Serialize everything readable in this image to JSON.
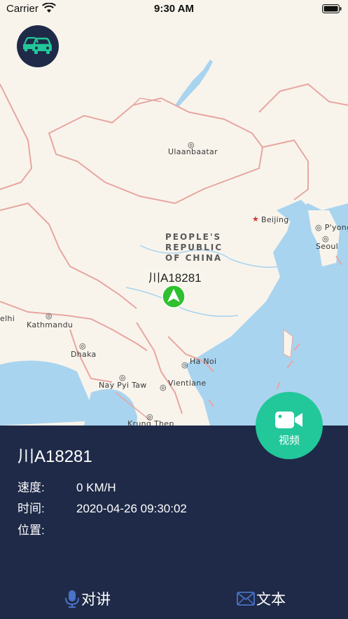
{
  "status_bar": {
    "carrier": "Carrier",
    "time": "9:30 AM"
  },
  "map": {
    "labels": {
      "ulaanbaatar": "Ulaanbaatar",
      "beijing": "Beijing",
      "pyong": "P'yong",
      "seoul": "Seoul",
      "kathmandu": "Kathmandu",
      "delhi": "elhi",
      "dhaka": "Dhaka",
      "hanoi": "Ha Noi",
      "naypyitaw": "Nay Pyi Taw",
      "vientiane": "Vientiane",
      "bangkok": "Krung Thep"
    },
    "country": {
      "line1": "PEOPLE'S",
      "line2": "REPUBLIC",
      "line3": "OF CHINA"
    }
  },
  "vehicle_marker": {
    "label": "川A18281"
  },
  "video_button": {
    "label": "视频"
  },
  "detail": {
    "plate": "川A18281",
    "speed_label": "速度:",
    "speed_value": "0 KM/H",
    "time_label": "时间:",
    "time_value": "2020-04-26 09:30:02",
    "position_label": "位置:",
    "position_value": ""
  },
  "actions": {
    "intercom": "对讲",
    "text": "文本"
  },
  "colors": {
    "panel": "#1f2a48",
    "accent": "#22c79a",
    "marker": "#2ec02e"
  }
}
